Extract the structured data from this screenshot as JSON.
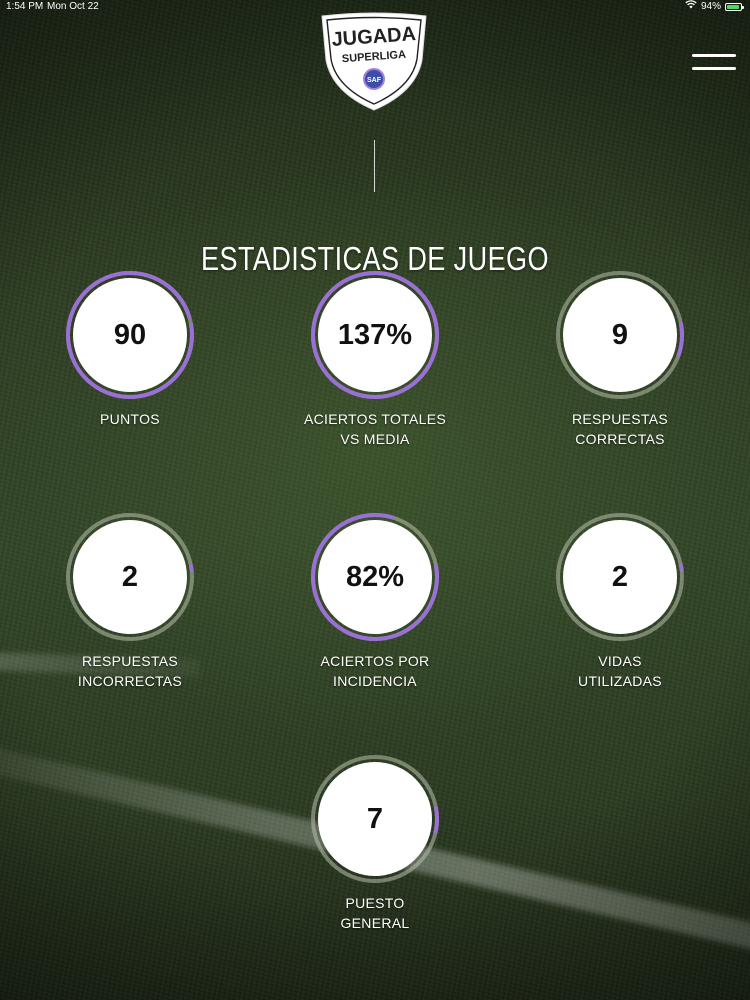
{
  "status_bar": {
    "time": "1:54 PM",
    "date": "Mon Oct 22",
    "battery": "94%",
    "wifi_icon": "wifi-icon",
    "battery_icon": "battery-charging-icon"
  },
  "header": {
    "logo_text_top": "JUGADA",
    "logo_text_bottom": "SUPERLIGA",
    "logo_badge": "SAF",
    "menu_icon": "hamburger-menu-icon"
  },
  "page": {
    "title": "ESTADISTICAS DE JUEGO"
  },
  "colors": {
    "accent": "#9a6fd6",
    "ring_track": "#b8bfad",
    "circle_fill": "#ffffff"
  },
  "stats": [
    {
      "value": "90",
      "label_line1": "PUNTOS",
      "label_line2": "",
      "progress": 0.98
    },
    {
      "value": "137%",
      "label_line1": "ACIERTOS TOTALES",
      "label_line2": "VS MEDIA",
      "progress": 1.0
    },
    {
      "value": "9",
      "label_line1": "RESPUESTAS",
      "label_line2": "CORRECTAS",
      "progress": 0.08
    },
    {
      "value": "2",
      "label_line1": "RESPUESTAS",
      "label_line2": "INCORRECTAS",
      "progress": 0.01
    },
    {
      "value": "82%",
      "label_line1": "ACIERTOS POR",
      "label_line2": "INCIDENCIA",
      "progress": 0.82
    },
    {
      "value": "2",
      "label_line1": "VIDAS",
      "label_line2": "UTILIZADAS",
      "progress": 0.01
    },
    {
      "value": "7",
      "label_line1": "PUESTO",
      "label_line2": "GENERAL",
      "progress": 0.06
    }
  ]
}
